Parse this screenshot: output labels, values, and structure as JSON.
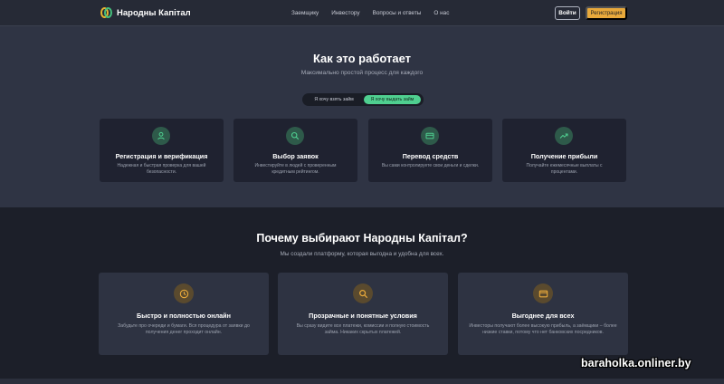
{
  "header": {
    "brand": "Народны Капітал",
    "nav": [
      "Заемщику",
      "Инвестору",
      "Вопросы и ответы",
      "О нас"
    ],
    "login_label": "Войти",
    "register_label": "Регистрация"
  },
  "how_it_works": {
    "title": "Как это работает",
    "subtitle": "Максимально простой процесс для каждого",
    "toggle": {
      "option_borrow": "Я хочу взять займ",
      "option_lend": "Я хочу выдать займ",
      "active": "option_lend"
    },
    "steps": [
      {
        "title": "Регистрация и верификация",
        "description": "Надежная и быстрая проверка для вашей безопасности.",
        "icon": "user-icon"
      },
      {
        "title": "Выбор заявок",
        "description": "Инвестируйте в людей с проверенным кредитным рейтингом.",
        "icon": "search-icon"
      },
      {
        "title": "Перевод средств",
        "description": "Вы сами контролируете свои деньги и сделки.",
        "icon": "credit-card-icon"
      },
      {
        "title": "Получение прибыли",
        "description": "Получайте ежемесячные выплаты с процентами.",
        "icon": "trending-up-icon"
      }
    ]
  },
  "why_us": {
    "title": "Почему выбирают Народны Капітал?",
    "subtitle": "Мы создали платформу, которая выгодна и удобна для всех.",
    "features": [
      {
        "title": "Быстро и полностью онлайн",
        "description": "Забудьте про очереди и бумаги. Вся процедура от заявки до получения денег проходит онлайн.",
        "icon": "clock-icon"
      },
      {
        "title": "Прозрачные и понятные условия",
        "description": "Вы сразу видите все платежи, комиссии и полную стоимость займа. Никаких скрытых платежей.",
        "icon": "search-icon"
      },
      {
        "title": "Выгоднее для всех",
        "description": "Инвесторы получают более высокую прибыль, а заёмщики – более низкие ставки, потому что нет банковских посредников.",
        "icon": "wallet-icon"
      }
    ]
  },
  "watermark": "baraholka.onliner.by",
  "colors": {
    "accent_green": "#4fcf90",
    "accent_orange": "#e8a93b",
    "background": "#2f3444",
    "background_dark": "#1c1f29"
  }
}
